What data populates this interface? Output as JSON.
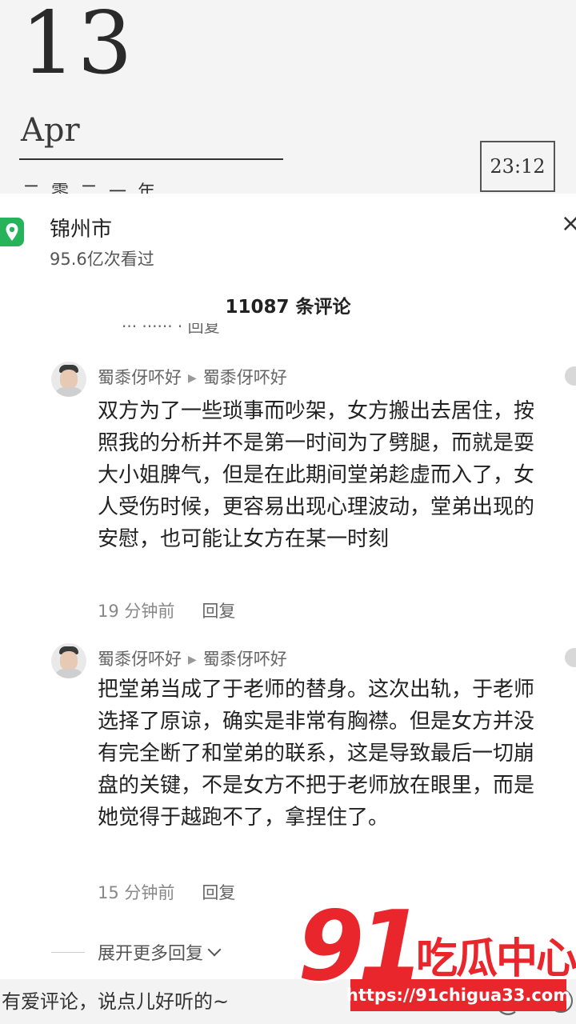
{
  "calendar": {
    "day": "13",
    "month": "Apr",
    "subtitle": "二零二一年",
    "time": "23:12"
  },
  "location": {
    "name": "锦州市",
    "views": "95.6亿次看过",
    "close": "×"
  },
  "panel": {
    "title": "11087 条评论",
    "cut_text": "··· ······ · 回复"
  },
  "comments": [
    {
      "author": "蜀黍伢吥好",
      "reply_to": "蜀黍伢吥好",
      "text": "双方为了一些琐事而吵架，女方搬出去居住，按照我的分析并不是第一时间为了劈腿，而就是耍大小姐脾气，但是在此期间堂弟趁虚而入了，女人受伤时候，更容易出现心理波动，堂弟出现的安慰，也可能让女方在某一时刻",
      "time": "19 分钟前",
      "reply_label": "回复"
    },
    {
      "author": "蜀黍伢吥好",
      "reply_to": "蜀黍伢吥好",
      "text": "把堂弟当成了于老师的替身。这次出轨，于老师选择了原谅，确实是非常有胸襟。但是女方并没有完全断了和堂弟的联系，这是导致最后一切崩盘的关键，不是女方不把于老师放在眼里，而是她觉得于越跑不了，拿捏住了。",
      "time": "15 分钟前",
      "reply_label": "回复"
    }
  ],
  "expand": {
    "label": "展开更多回复"
  },
  "input": {
    "placeholder": "有爱评论，说点儿好听的~"
  },
  "watermark": {
    "number": "91",
    "name": "吃瓜中心",
    "url": "https://91chigua33.com"
  },
  "colors": {
    "brand_red": "#e8262c",
    "location_green": "#27b35a"
  }
}
